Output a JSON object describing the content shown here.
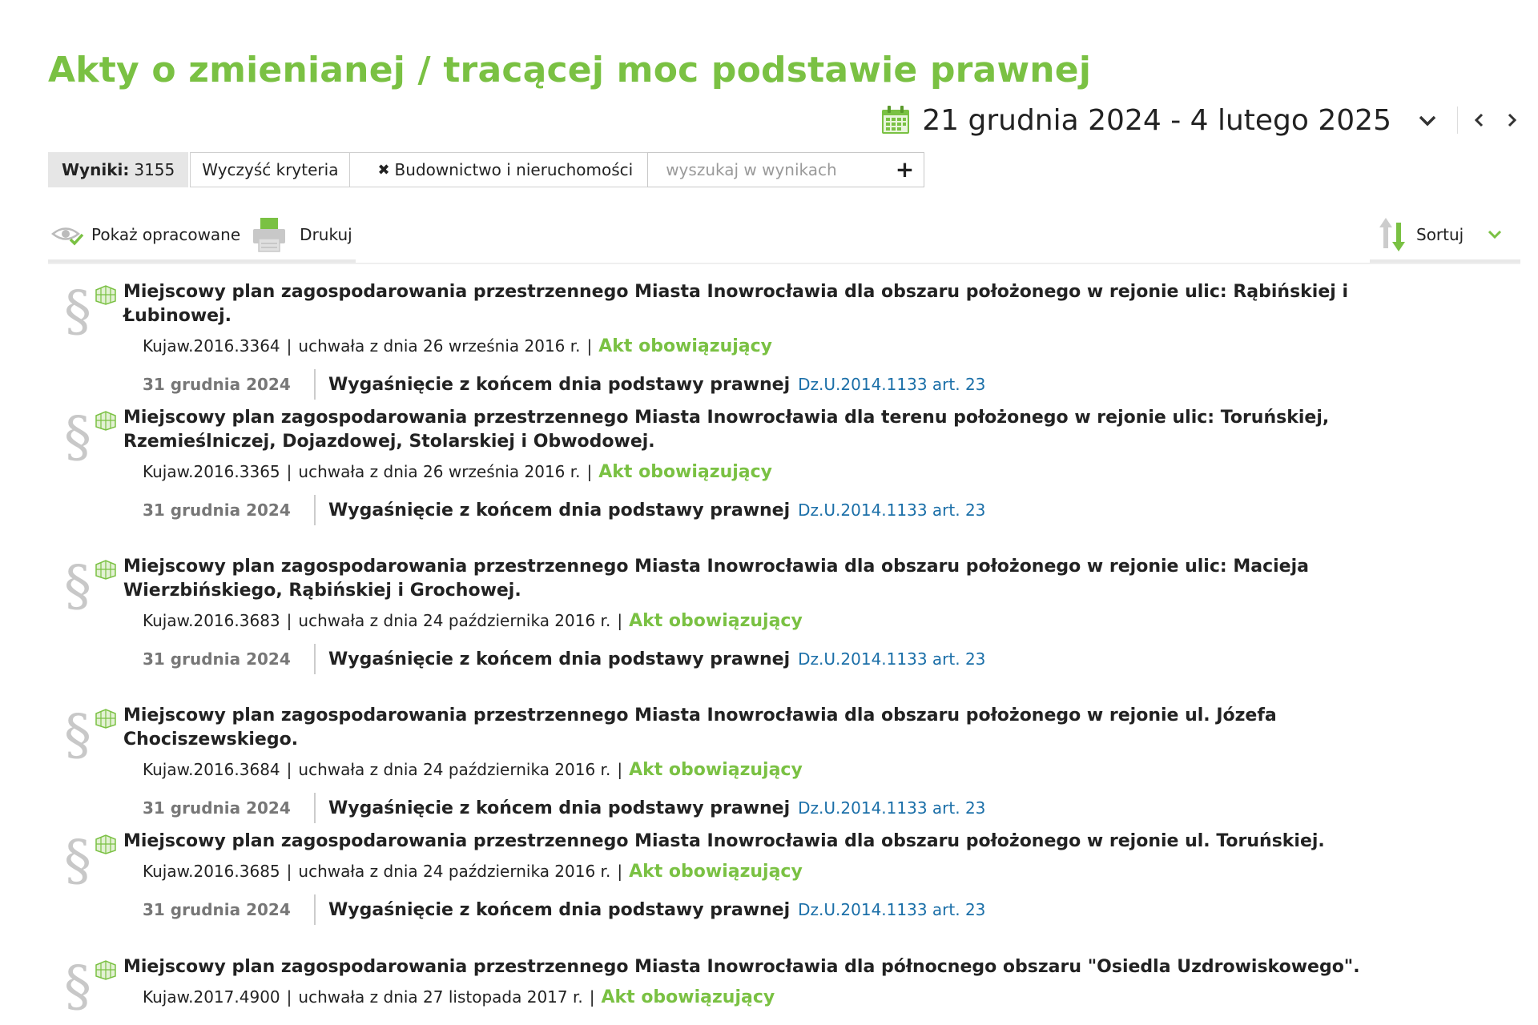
{
  "title": "Akty o zmienianej / tracącej moc podstawie prawnej",
  "date_range": "21 grudnia 2024 - 4 lutego 2025",
  "filters": {
    "results_label": "Wyniki:",
    "results_count": "3155",
    "clear_label": "Wyczyść kryteria",
    "tag_x": "✖",
    "tag_label": "Budownictwo i nieruchomości",
    "search_placeholder": "wyszukaj w wynikach",
    "plus": "+"
  },
  "toolbar": {
    "show_processed": "Pokaż opracowane",
    "print": "Drukuj",
    "sort": "Sortuj"
  },
  "colors": {
    "accent_green": "#7ac143",
    "link_blue": "#1b6fa8",
    "results_bg": "#e6e6e6"
  },
  "results": [
    {
      "title": "Miejscowy plan zagospodarowania przestrzennego Miasta Inowrocławia dla obszaru położonego w rejonie ulic: Rąbińskiej i Łubinowej.",
      "id": "Kujaw.2016.3364",
      "type_date": "uchwała z dnia 26 września 2016 r.",
      "status": "Akt obowiązujący",
      "event_date": "31 grudnia 2024",
      "event_text": "Wygaśnięcie z końcem dnia podstawy prawnej",
      "event_link": "Dz.U.2014.1133 art. 23"
    },
    {
      "title": "Miejscowy plan zagospodarowania przestrzennego Miasta Inowrocławia dla terenu położonego w rejonie ulic: Toruńskiej, Rzemieślniczej, Dojazdowej, Stolarskiej i Obwodowej.",
      "id": "Kujaw.2016.3365",
      "type_date": "uchwała z dnia 26 września 2016 r.",
      "status": "Akt obowiązujący",
      "event_date": "31 grudnia 2024",
      "event_text": "Wygaśnięcie z końcem dnia podstawy prawnej",
      "event_link": "Dz.U.2014.1133 art. 23"
    },
    {
      "title": "Miejscowy plan zagospodarowania przestrzennego Miasta Inowrocławia dla obszaru położonego w rejonie ulic: Macieja Wierzbińskiego, Rąbińskiej i Grochowej.",
      "id": "Kujaw.2016.3683",
      "type_date": "uchwała z dnia 24 października 2016 r.",
      "status": "Akt obowiązujący",
      "event_date": "31 grudnia 2024",
      "event_text": "Wygaśnięcie z końcem dnia podstawy prawnej",
      "event_link": "Dz.U.2014.1133 art. 23"
    },
    {
      "title": "Miejscowy plan zagospodarowania przestrzennego Miasta Inowrocławia dla obszaru położonego w rejonie ul. Józefa Chociszewskiego.",
      "id": "Kujaw.2016.3684",
      "type_date": "uchwała z dnia 24 października 2016 r.",
      "status": "Akt obowiązujący",
      "event_date": "31 grudnia 2024",
      "event_text": "Wygaśnięcie z końcem dnia podstawy prawnej",
      "event_link": "Dz.U.2014.1133 art. 23"
    },
    {
      "title": "Miejscowy plan zagospodarowania przestrzennego Miasta Inowrocławia dla obszaru położonego w rejonie ul. Toruńskiej.",
      "id": "Kujaw.2016.3685",
      "type_date": "uchwała z dnia 24 października 2016 r.",
      "status": "Akt obowiązujący",
      "event_date": "31 grudnia 2024",
      "event_text": "Wygaśnięcie z końcem dnia podstawy prawnej",
      "event_link": "Dz.U.2014.1133 art. 23"
    },
    {
      "title": "Miejscowy plan zagospodarowania przestrzennego Miasta Inowrocławia dla północnego obszaru \"Osiedla Uzdrowiskowego\".",
      "id": "Kujaw.2017.4900",
      "type_date": "uchwała z dnia 27 listopada 2017 r.",
      "status": "Akt obowiązujący"
    }
  ]
}
